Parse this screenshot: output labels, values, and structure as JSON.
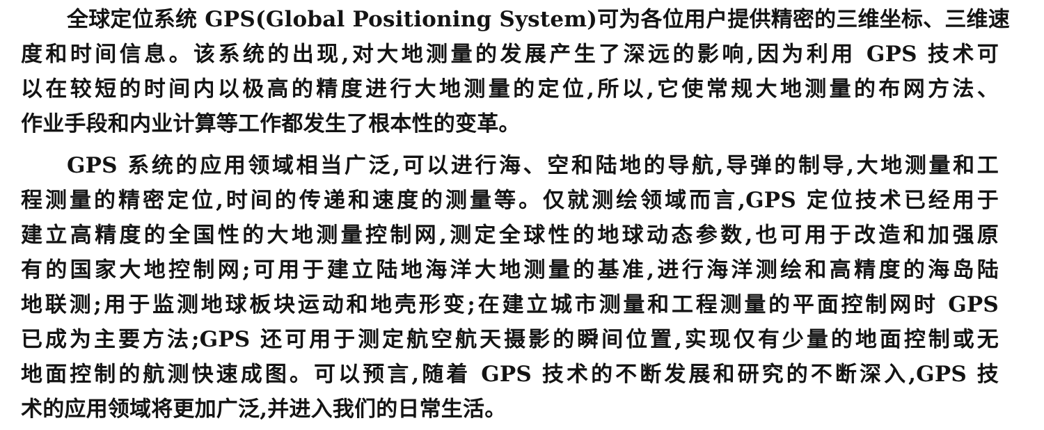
{
  "document": {
    "paragraphs": [
      {
        "lines": [
          "全球定位系统 GPS(Global Positioning System)可为各位用户提供精密的三维坐标、三维速",
          "度和时间信息。该系统的出现,对大地测量的发展产生了深远的影响,因为利用 GPS 技术可",
          "以在较短的时间内以极高的精度进行大地测量的定位,所以,它使常规大地测量的布网方法、",
          "作业手段和内业计算等工作都发生了根本性的变革。"
        ]
      },
      {
        "lines": [
          "GPS 系统的应用领域相当广泛,可以进行海、空和陆地的导航,导弹的制导,大地测量和工",
          "程测量的精密定位,时间的传递和速度的测量等。仅就测绘领域而言,GPS 定位技术已经用于",
          "建立高精度的全国性的大地测量控制网,测定全球性的地球动态参数,也可用于改造和加强原",
          "有的国家大地控制网;可用于建立陆地海洋大地测量的基准,进行海洋测绘和高精度的海岛陆",
          "地联测;用于监测地球板块运动和地壳形变;在建立城市测量和工程测量的平面控制网时 GPS",
          "已成为主要方法;GPS 还可用于测定航空航天摄影的瞬间位置,实现仅有少量的地面控制或无",
          "地面控制的航测快速成图。可以预言,随着 GPS 技术的不断发展和研究的不断深入,GPS 技",
          "术的应用领域将更加广泛,并进入我们的日常生活。"
        ]
      }
    ]
  }
}
